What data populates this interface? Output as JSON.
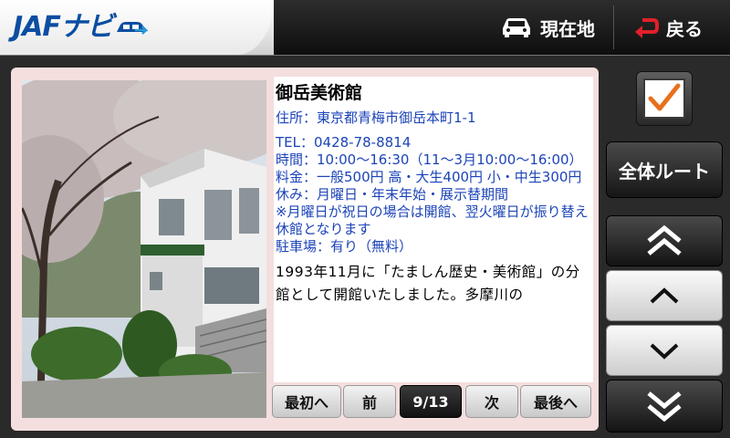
{
  "header": {
    "logo_text": "JAFナビ",
    "current_location_label": "現在地",
    "back_label": "戻る"
  },
  "detail": {
    "title": "御岳美術館",
    "address": "住所：東京都青梅市御岳本町1-1",
    "tel": "TEL：0428-78-8814",
    "hours": "時間：10:00～16:30（11～3月10:00～16:00）",
    "fee": "料金：一般500円 高・大生400円 小・中生300円",
    "closed": "休み：月曜日・年末年始・展示替期間",
    "note": "※月曜日が祝日の場合は開館、翌火曜日が振り替え休館となります",
    "parking": "駐車場：有り（無料）",
    "description": "1993年11月に「たましん歴史・美術館」の分館として開館いたしました。多摩川の"
  },
  "pager": {
    "first_label": "最初へ",
    "prev_label": "前",
    "count": "9/13",
    "next_label": "次",
    "last_label": "最後へ"
  },
  "controls": {
    "all_route_label": "全体ルート",
    "checkbox_checked": true
  },
  "colors": {
    "accent_blue": "#1c44b8",
    "check_orange": "#e8701c",
    "back_arrow_red": "#e0202a"
  },
  "icons": [
    "car-icon",
    "back-arrow-icon",
    "checkmark-icon",
    "double-chevron-up-icon",
    "chevron-up-icon",
    "chevron-down-icon",
    "double-chevron-down-icon"
  ]
}
